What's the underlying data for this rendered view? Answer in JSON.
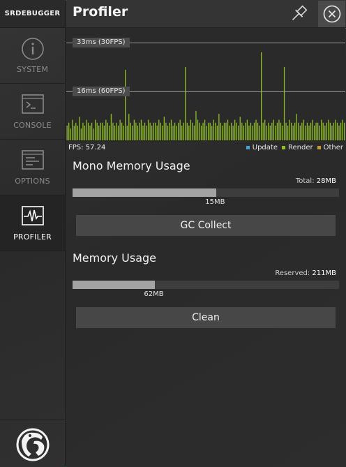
{
  "sidebar": {
    "brand": "SRDEBUGGER",
    "items": [
      {
        "label": "SYSTEM",
        "icon": "info-icon"
      },
      {
        "label": "CONSOLE",
        "icon": "console-icon"
      },
      {
        "label": "OPTIONS",
        "icon": "options-icon"
      },
      {
        "label": "PROFILER",
        "icon": "profiler-icon",
        "active": true
      }
    ],
    "logo_icon": "stompy-logo-icon"
  },
  "header": {
    "title": "Profiler",
    "pin_icon": "pin-icon",
    "close_icon": "close-icon"
  },
  "graph": {
    "line_33": "33ms (30FPS)",
    "line_16": "16ms (60FPS)",
    "fps_text": "FPS: 57.24",
    "legend": [
      {
        "label": "Update",
        "color": "#4a9fd8"
      },
      {
        "label": "Render",
        "color": "#8fbf22"
      },
      {
        "label": "Other",
        "color": "#c89a2e"
      }
    ],
    "bar_color": "#8fbf22",
    "frame_times_ms": [
      5,
      6,
      4,
      7,
      5,
      6,
      5,
      8,
      4,
      6,
      5,
      7,
      6,
      5,
      6,
      4,
      7,
      6,
      5,
      6,
      6,
      5,
      7,
      6,
      5,
      9,
      6,
      5,
      6,
      5,
      7,
      6,
      5,
      24,
      5,
      9,
      6,
      5,
      7,
      6,
      5,
      6,
      7,
      5,
      6,
      5,
      7,
      6,
      5,
      6,
      6,
      5,
      7,
      6,
      5,
      8,
      6,
      5,
      6,
      7,
      5,
      6,
      5,
      6,
      7,
      5,
      6,
      25,
      6,
      5,
      7,
      6,
      5,
      10,
      7,
      6,
      5,
      6,
      7,
      5,
      6,
      6,
      5,
      7,
      6,
      5,
      9,
      6,
      5,
      6,
      6,
      7,
      5,
      6,
      5,
      7,
      6,
      5,
      8,
      6,
      5,
      6,
      7,
      5,
      6,
      5,
      6,
      7,
      6,
      5,
      30,
      6,
      7,
      5,
      6,
      5,
      6,
      7,
      5,
      6,
      7,
      6,
      5,
      25,
      6,
      5,
      7,
      6,
      5,
      6,
      9,
      6,
      5,
      6,
      7,
      5,
      6,
      5,
      6,
      7,
      5,
      6,
      6,
      5,
      7,
      6,
      5,
      6,
      7,
      6,
      5,
      6,
      7,
      6,
      5,
      6,
      7,
      6
    ]
  },
  "mono_memory": {
    "title": "Mono Memory Usage",
    "total_label": "Total:",
    "total_value": "28MB",
    "used_label": "15MB",
    "used_fraction": 0.54,
    "button_label": "GC Collect"
  },
  "memory": {
    "title": "Memory Usage",
    "reserved_label": "Reserved:",
    "reserved_value": "211MB",
    "used_label": "62MB",
    "used_fraction": 0.31,
    "button_label": "Clean"
  }
}
